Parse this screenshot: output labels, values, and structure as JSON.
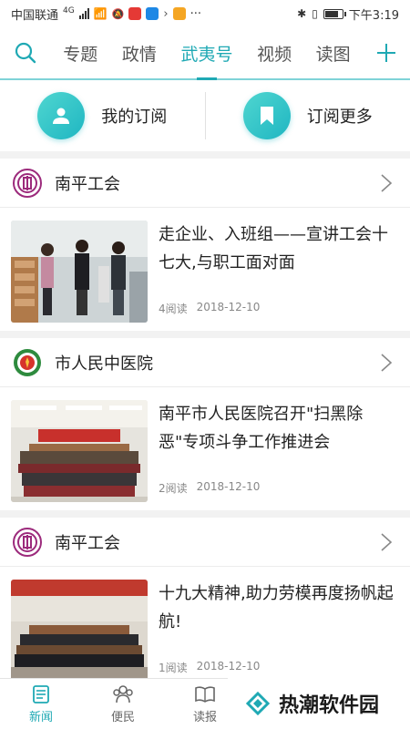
{
  "status_bar": {
    "carrier": "中国联通",
    "network": "4G",
    "time": "下午3:19",
    "battery_level": 0.8
  },
  "top_nav": {
    "tabs": [
      {
        "label": "专题",
        "active": false
      },
      {
        "label": "政情",
        "active": false
      },
      {
        "label": "武夷号",
        "active": true
      },
      {
        "label": "视频",
        "active": false
      },
      {
        "label": "读图",
        "active": false
      }
    ],
    "accent_color": "#1fa9b4"
  },
  "subscribe": {
    "mine_label": "我的订阅",
    "more_label": "订阅更多"
  },
  "feed": [
    {
      "org_name": "南平工会",
      "org_logo": "union-logo-icon",
      "title": "走企业、入班组——宣讲工会十七大,与职工面对面",
      "reads": "4阅读",
      "date": "2018-12-10"
    },
    {
      "org_name": "市人民中医院",
      "org_logo": "hospital-logo-icon",
      "title": "南平市人民医院召开\"扫黑除恶\"专项斗争工作推进会",
      "reads": "2阅读",
      "date": "2018-12-10"
    },
    {
      "org_name": "南平工会",
      "org_logo": "union-logo-icon",
      "title": "十九大精神,助力劳模再度扬帆起航!",
      "reads": "1阅读",
      "date": "2018-12-10"
    }
  ],
  "bottom_nav": [
    {
      "label": "新闻",
      "icon": "news-icon",
      "active": true
    },
    {
      "label": "便民",
      "icon": "people-icon",
      "active": false
    },
    {
      "label": "读报",
      "icon": "book-icon",
      "active": false
    }
  ],
  "watermark": {
    "text": "热潮软件园"
  }
}
